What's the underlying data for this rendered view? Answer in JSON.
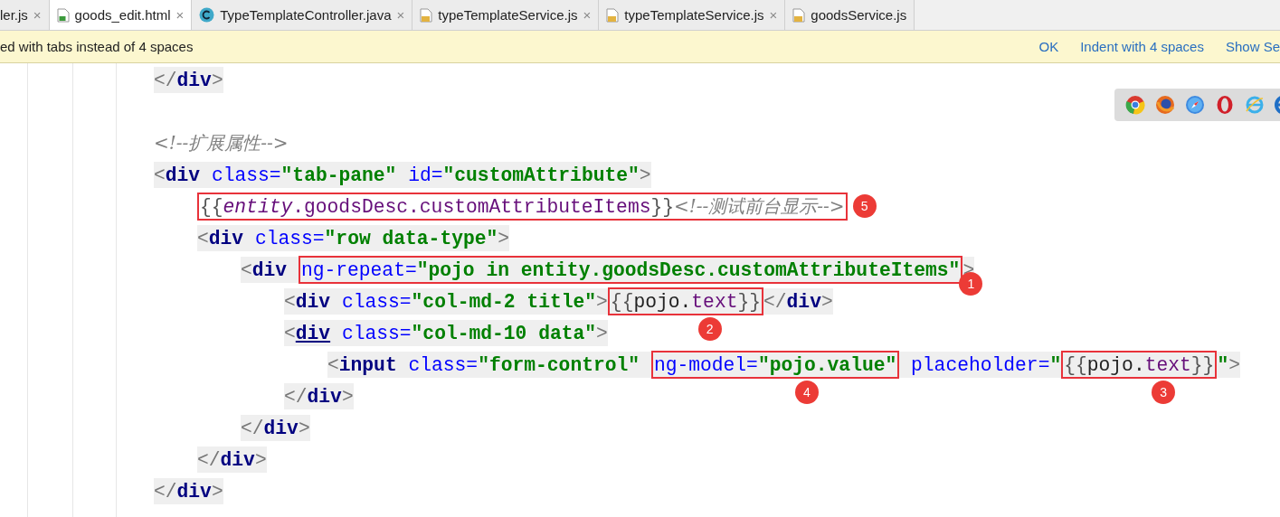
{
  "tabs": [
    {
      "label": "ler.js",
      "kind": "plain",
      "close": "×",
      "selected": false
    },
    {
      "label": "goods_edit.html",
      "kind": "html",
      "close": "×",
      "selected": true
    },
    {
      "label": "TypeTemplateController.java",
      "kind": "java",
      "close": "×",
      "selected": false
    },
    {
      "label": "typeTemplateService.js",
      "kind": "js",
      "close": "×",
      "selected": false
    },
    {
      "label": "typeTemplateService.js",
      "kind": "js",
      "close": "×",
      "selected": false
    },
    {
      "label": "goodsService.js",
      "kind": "js",
      "selected": false
    }
  ],
  "notification": {
    "message": "ed with tabs instead of 4 spaces",
    "actions": [
      "OK",
      "Indent with 4 spaces",
      "Show Se"
    ]
  },
  "editor": {
    "lines": [
      {
        "kind": "code",
        "shaded": true,
        "segments": [
          {
            "kind": "code",
            "tokens": [
              {
                "kind": "punct",
                "text": "</"
              },
              {
                "kind": "tag",
                "text": "div"
              },
              {
                "kind": "punct",
                "text": ">"
              }
            ]
          }
        ]
      },
      {
        "kind": "blank"
      },
      {
        "kind": "code",
        "shaded": false,
        "segments": [
          {
            "kind": "code",
            "tokens": [
              {
                "kind": "comment",
                "text": "<!--扩展属性-->"
              }
            ]
          }
        ]
      },
      {
        "kind": "code",
        "shaded": true,
        "segments": [
          {
            "kind": "code",
            "tokens": [
              {
                "kind": "punct",
                "text": "<"
              },
              {
                "kind": "tag",
                "text": "div "
              },
              {
                "kind": "attr",
                "text": "class="
              },
              {
                "kind": "str",
                "text": "\"tab-pane\" "
              },
              {
                "kind": "attr",
                "text": "id="
              },
              {
                "kind": "str",
                "text": "\"customAttribute\""
              },
              {
                "kind": "punct",
                "text": ">"
              }
            ]
          }
        ],
        "children": [
          {
            "kind": "code",
            "shaded": false,
            "segments": [
              {
                "kind": "callout_right",
                "number": "5",
                "tokens": [
                  {
                    "kind": "brace",
                    "text": "{{"
                  },
                  {
                    "kind": "var_italic",
                    "text": "entity"
                  },
                  {
                    "kind": "var",
                    "text": ".goodsDesc.customAttributeItems"
                  },
                  {
                    "kind": "brace",
                    "text": "}}"
                  },
                  {
                    "kind": "comment",
                    "text": "<!--测试前台显示-->"
                  }
                ]
              }
            ]
          },
          {
            "kind": "code",
            "shaded": true,
            "segments": [
              {
                "kind": "code",
                "tokens": [
                  {
                    "kind": "punct",
                    "text": "<"
                  },
                  {
                    "kind": "tag",
                    "text": "div "
                  },
                  {
                    "kind": "attr",
                    "text": "class="
                  },
                  {
                    "kind": "str",
                    "text": "\"row data-type\""
                  },
                  {
                    "kind": "punct",
                    "text": ">"
                  }
                ]
              }
            ],
            "children": [
              {
                "kind": "code",
                "shaded": true,
                "segments": [
                  {
                    "kind": "code",
                    "tokens": [
                      {
                        "kind": "punct",
                        "text": "<"
                      },
                      {
                        "kind": "tag",
                        "text": "div "
                      }
                    ]
                  },
                  {
                    "kind": "callout_corner",
                    "number": "1",
                    "tokens": [
                      {
                        "kind": "attr",
                        "text": "ng-repeat="
                      },
                      {
                        "kind": "str",
                        "text": "\"pojo in entity.goodsDesc.customAttributeItems\""
                      }
                    ]
                  },
                  {
                    "kind": "code",
                    "tokens": [
                      {
                        "kind": "punct",
                        "text": ">"
                      }
                    ]
                  }
                ],
                "children": [
                  {
                    "kind": "code",
                    "shaded": true,
                    "segments": [
                      {
                        "kind": "code",
                        "tokens": [
                          {
                            "kind": "punct",
                            "text": "<"
                          },
                          {
                            "kind": "tag",
                            "text": "div "
                          },
                          {
                            "kind": "attr",
                            "text": "class="
                          },
                          {
                            "kind": "str",
                            "text": "\"col-md-2 title\""
                          },
                          {
                            "kind": "punct",
                            "text": ">"
                          }
                        ]
                      },
                      {
                        "kind": "callout_below",
                        "number": "2",
                        "tokens": [
                          {
                            "kind": "brace",
                            "text": "{{"
                          },
                          {
                            "kind": "plain",
                            "text": "pojo."
                          },
                          {
                            "kind": "var",
                            "text": "text"
                          },
                          {
                            "kind": "brace",
                            "text": "}}"
                          }
                        ]
                      },
                      {
                        "kind": "code",
                        "tokens": [
                          {
                            "kind": "punct",
                            "text": "</"
                          },
                          {
                            "kind": "tag",
                            "text": "div"
                          },
                          {
                            "kind": "punct",
                            "text": ">"
                          }
                        ]
                      }
                    ]
                  },
                  {
                    "kind": "code",
                    "shaded": true,
                    "segments": [
                      {
                        "kind": "code",
                        "tokens": [
                          {
                            "kind": "punct",
                            "text": "<"
                          },
                          {
                            "kind": "tag_underlined",
                            "text": "div"
                          },
                          {
                            "kind": "attr",
                            "text": " class="
                          },
                          {
                            "kind": "str",
                            "text": "\"col-md-10 data\""
                          },
                          {
                            "kind": "punct",
                            "text": ">"
                          }
                        ]
                      }
                    ],
                    "children": [
                      {
                        "kind": "code",
                        "shaded": true,
                        "segments": [
                          {
                            "kind": "code",
                            "tokens": [
                              {
                                "kind": "punct",
                                "text": "<"
                              },
                              {
                                "kind": "tag",
                                "text": "input "
                              },
                              {
                                "kind": "attr",
                                "text": "class="
                              },
                              {
                                "kind": "str",
                                "text": "\"form-control\" "
                              }
                            ]
                          },
                          {
                            "kind": "callout_below",
                            "number": "4",
                            "tokens": [
                              {
                                "kind": "attr",
                                "text": "ng-model="
                              },
                              {
                                "kind": "str",
                                "text": "\"pojo.value\""
                              }
                            ]
                          },
                          {
                            "kind": "code",
                            "tokens": [
                              {
                                "kind": "attr",
                                "text": " placeholder="
                              },
                              {
                                "kind": "str",
                                "text": "\""
                              }
                            ]
                          },
                          {
                            "kind": "callout_below",
                            "number": "3",
                            "tokens": [
                              {
                                "kind": "brace",
                                "text": "{{"
                              },
                              {
                                "kind": "plain",
                                "text": "pojo."
                              },
                              {
                                "kind": "var",
                                "text": "text"
                              },
                              {
                                "kind": "brace",
                                "text": "}}"
                              }
                            ]
                          },
                          {
                            "kind": "code",
                            "tokens": [
                              {
                                "kind": "str",
                                "text": "\""
                              },
                              {
                                "kind": "punct",
                                "text": ">"
                              }
                            ]
                          }
                        ]
                      }
                    ]
                  },
                  {
                    "kind": "code",
                    "shaded": true,
                    "segments": [
                      {
                        "kind": "code",
                        "tokens": [
                          {
                            "kind": "punct",
                            "text": "</"
                          },
                          {
                            "kind": "tag",
                            "text": "div"
                          },
                          {
                            "kind": "punct",
                            "text": ">"
                          }
                        ]
                      }
                    ]
                  }
                ]
              },
              {
                "kind": "code",
                "shaded": true,
                "segments": [
                  {
                    "kind": "code",
                    "tokens": [
                      {
                        "kind": "punct",
                        "text": "</"
                      },
                      {
                        "kind": "tag",
                        "text": "div"
                      },
                      {
                        "kind": "punct",
                        "text": ">"
                      }
                    ]
                  }
                ]
              }
            ]
          },
          {
            "kind": "code",
            "shaded": true,
            "segments": [
              {
                "kind": "code",
                "tokens": [
                  {
                    "kind": "punct",
                    "text": "</"
                  },
                  {
                    "kind": "tag",
                    "text": "div"
                  },
                  {
                    "kind": "punct",
                    "text": ">"
                  }
                ]
              }
            ]
          }
        ]
      },
      {
        "kind": "code",
        "shaded": true,
        "segments": [
          {
            "kind": "code",
            "tokens": [
              {
                "kind": "punct",
                "text": "</"
              },
              {
                "kind": "tag",
                "text": "div"
              },
              {
                "kind": "punct",
                "text": ">"
              }
            ]
          }
        ]
      }
    ]
  }
}
